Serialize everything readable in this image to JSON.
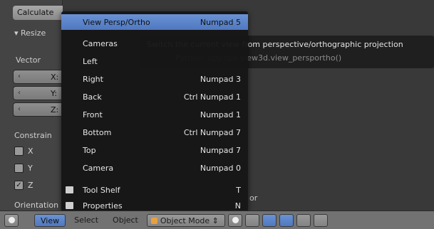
{
  "tool_panel": {
    "operator_button": "Calculate",
    "resize_header": "▾ Resize",
    "vector_label": "Vector",
    "vector_fields": [
      {
        "arrow": "‹",
        "axis": "X:"
      },
      {
        "arrow": "‹",
        "axis": "Y:"
      },
      {
        "arrow": "‹",
        "axis": "Z:"
      }
    ],
    "constraint_label": "Constrain",
    "constraint_axes": [
      {
        "label": "X",
        "checked": false
      },
      {
        "label": "Y",
        "checked": false
      },
      {
        "label": "Z",
        "checked": true
      }
    ],
    "orientation_label": "Orientation"
  },
  "view_menu": {
    "items": [
      {
        "label": "View Persp/Ortho",
        "shortcut": "Numpad 5",
        "active": true,
        "icon": ""
      },
      {
        "label": "Cameras",
        "shortcut": "",
        "active": false,
        "icon": ""
      },
      {
        "label": "Left",
        "shortcut": "",
        "active": false,
        "icon": ""
      },
      {
        "label": "Right",
        "shortcut": "Numpad 3",
        "active": false,
        "icon": ""
      },
      {
        "label": "Back",
        "shortcut": "Ctrl Numpad 1",
        "active": false,
        "icon": ""
      },
      {
        "label": "Front",
        "shortcut": "Numpad 1",
        "active": false,
        "icon": ""
      },
      {
        "label": "Bottom",
        "shortcut": "Ctrl Numpad 7",
        "active": false,
        "icon": ""
      },
      {
        "label": "Top",
        "shortcut": "Numpad 7",
        "active": false,
        "icon": ""
      },
      {
        "label": "Camera",
        "shortcut": "Numpad 0",
        "active": false,
        "icon": ""
      },
      {
        "label": "Tool Shelf",
        "shortcut": "T",
        "active": false,
        "icon": "panel-icon"
      },
      {
        "label": "Properties",
        "shortcut": "N",
        "active": false,
        "icon": "panel-icon"
      }
    ]
  },
  "tooltip": {
    "description": "Switch the current view from perspective/orthographic projection",
    "python": "Python: bpy.ops.view3d.view_persportho()"
  },
  "viewport_partial_text": "or",
  "header": {
    "editor_type_icon": "cube-icon",
    "menus": [
      "View",
      "Select",
      "Object"
    ],
    "mode": "Object Mode",
    "colors": {
      "active": "#5a84cc",
      "header_bg": "#727272"
    }
  }
}
